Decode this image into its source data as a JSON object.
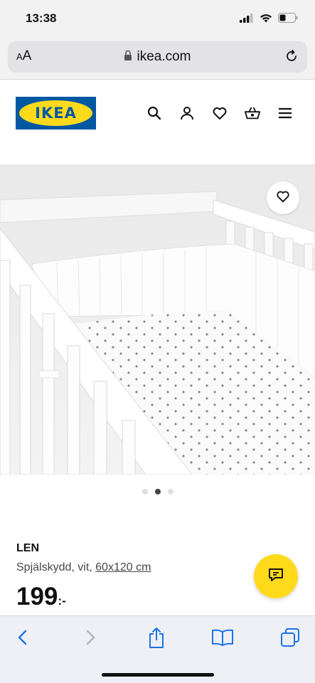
{
  "status_bar": {
    "time": "13:38"
  },
  "browser": {
    "text_size_button": {
      "small": "A",
      "large": "A"
    },
    "url": "ikea.com",
    "accent_color": "#1a73e8"
  },
  "site_header": {
    "logo_text": "IKEA",
    "brand_blue": "#0058a3",
    "brand_yellow": "#ffda1a",
    "icons": [
      "search-icon",
      "account-icon",
      "heart-icon",
      "basket-icon",
      "menu-icon"
    ]
  },
  "product": {
    "name": "LEN",
    "description": "Spjälskydd, vit, ",
    "size_link": "60x120 cm",
    "price_integer": "199",
    "price_suffix": ":-",
    "image_count": 3,
    "active_image_index": 1
  },
  "toolbar": {
    "icons": [
      "back-icon",
      "forward-icon",
      "share-icon",
      "bookmarks-icon",
      "tabs-icon"
    ]
  }
}
